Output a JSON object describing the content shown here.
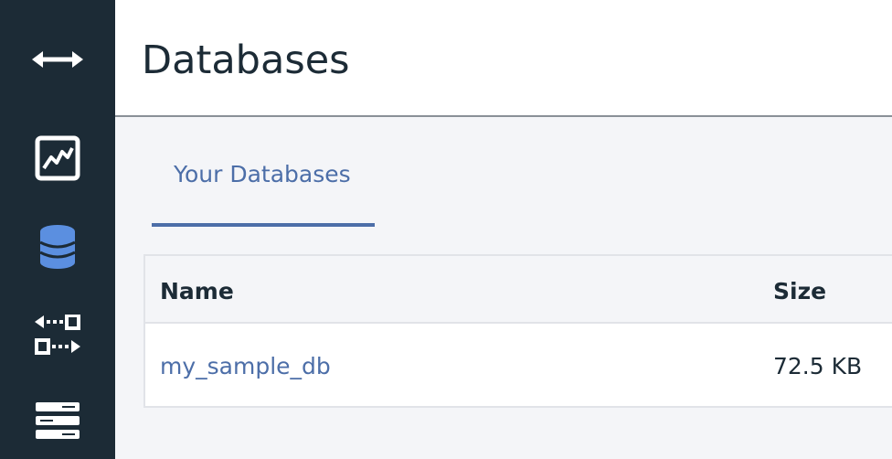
{
  "header": {
    "title": "Databases"
  },
  "sidebar": {
    "items": [
      {
        "icon": "expand-arrows-icon"
      },
      {
        "icon": "activity-chart-icon"
      },
      {
        "icon": "database-icon",
        "active": true
      },
      {
        "icon": "replication-icon"
      },
      {
        "icon": "server-stack-icon"
      }
    ],
    "icon_color": "#ffffff",
    "active_color": "#5b8fe0"
  },
  "tabs": [
    {
      "label": "Your Databases",
      "active": true
    }
  ],
  "table": {
    "columns": [
      "Name",
      "Size"
    ],
    "rows": [
      {
        "name": "my_sample_db",
        "size": "72.5 KB"
      }
    ]
  },
  "colors": {
    "sidebar_bg": "#1c2b36",
    "accent": "#4c6ea8",
    "text": "#1c2b36",
    "page_bg": "#f4f5f8"
  }
}
